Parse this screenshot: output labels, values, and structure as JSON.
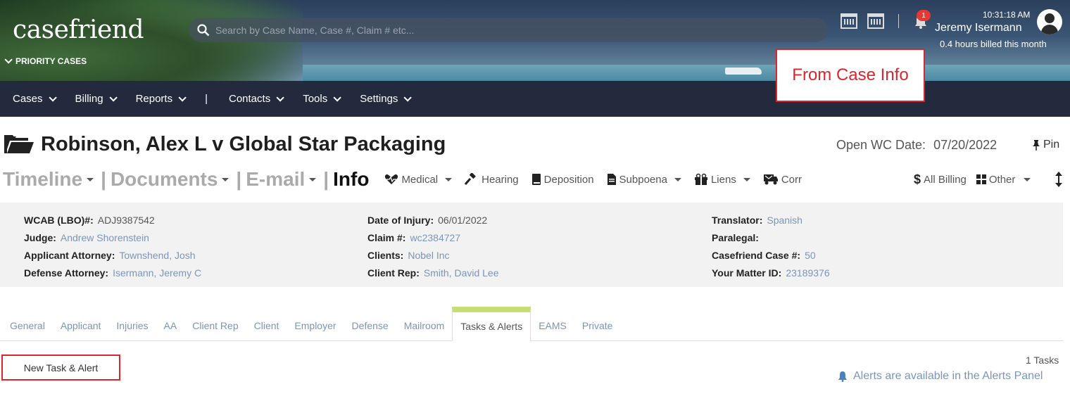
{
  "header": {
    "logo": "casefriend",
    "priority_label": "PRIORITY CASES",
    "search_placeholder": "Search by Case Name, Case #, Claim # etc...",
    "notifications_count": "1",
    "time": "10:31:18 AM",
    "user_name": "Jeremy Isermann",
    "billed": "0.4 hours billed this month"
  },
  "annotation": "From Case Info",
  "nav": {
    "items": [
      "Cases",
      "Billing",
      "Reports",
      "|",
      "Contacts",
      "Tools",
      "Settings"
    ]
  },
  "case": {
    "title": "Robinson, Alex L v Global Star Packaging",
    "open_date_label": "Open WC Date:",
    "open_date": "07/20/2022",
    "pin_label": "Pin"
  },
  "main_tabs": {
    "timeline": "Timeline",
    "documents": "Documents",
    "email": "E-mail",
    "info": "Info"
  },
  "sub_items": {
    "medical": "Medical",
    "hearing": "Hearing",
    "deposition": "Deposition",
    "subpoena": "Subpoena",
    "liens": "Liens",
    "corr": "Corr",
    "all_billing": "All Billing",
    "other": "Other"
  },
  "info": {
    "col1": [
      {
        "label": "WCAB (LBO)#:",
        "value": "ADJ9387542"
      },
      {
        "label": "Judge:",
        "value": "Andrew Shorenstein"
      },
      {
        "label": "Applicant Attorney:",
        "value": "Townshend, Josh"
      },
      {
        "label": "Defense Attorney:",
        "value": "Isermann, Jeremy C"
      }
    ],
    "col2": [
      {
        "label": "Date of Injury:",
        "value": "06/01/2022"
      },
      {
        "label": "Claim #:",
        "value": "wc2384727"
      },
      {
        "label": "Clients:",
        "value": "Nobel Inc"
      },
      {
        "label": "Client Rep:",
        "value": "Smith, David Lee"
      }
    ],
    "col3": [
      {
        "label": "Translator:",
        "value": "Spanish"
      },
      {
        "label": "Paralegal:",
        "value": ""
      },
      {
        "label": "Casefriend Case #:",
        "value": "50"
      },
      {
        "label": "Your Matter ID:",
        "value": "23189376"
      }
    ]
  },
  "sub_tabs": [
    "General",
    "Applicant",
    "Injuries",
    "AA",
    "Client Rep",
    "Client",
    "Employer",
    "Defense",
    "Mailroom",
    "Tasks & Alerts",
    "EAMS",
    "Private"
  ],
  "tasks": {
    "new_button": "New Task & Alert",
    "count": "1 Tasks",
    "alerts_note": "Alerts are available in the Alerts Panel"
  }
}
